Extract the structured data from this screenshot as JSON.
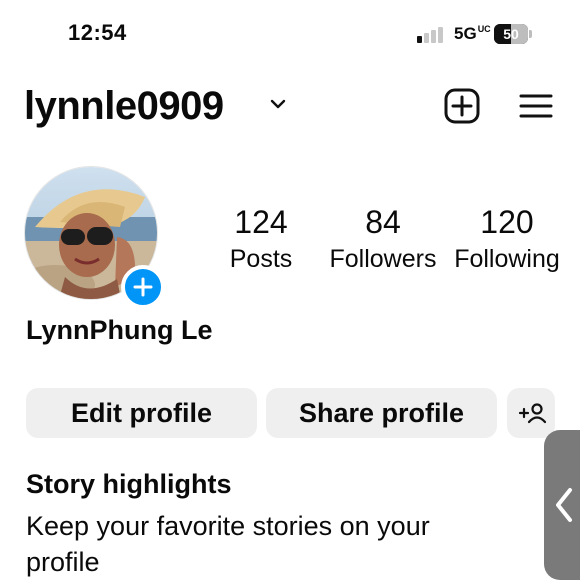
{
  "status": {
    "time": "12:54",
    "network": "5G",
    "network_badge": "UC",
    "battery": "50",
    "battery_level_percent": 50,
    "signal_bars_active": 1,
    "signal_bars_total": 4
  },
  "header": {
    "username": "lynnle0909",
    "icons": [
      "chevron-down-icon",
      "plus-square-icon",
      "hamburger-menu-icon"
    ]
  },
  "profile": {
    "full_name": "LynnPhung Le",
    "stats": {
      "posts_count": "124",
      "posts_label": "Posts",
      "followers_count": "84",
      "followers_label": "Followers",
      "following_count": "120",
      "following_label": "Following"
    }
  },
  "actions": {
    "edit_label": "Edit profile",
    "share_label": "Share profile",
    "add_person_icon": "add-person-icon"
  },
  "highlights": {
    "title": "Story highlights",
    "description": "Keep your favorite stories on your profile"
  },
  "colors": {
    "accent": "#0095f6",
    "button_bg": "#efefef",
    "text": "#0a0a0a",
    "side_tab": "#7a7a7a"
  }
}
